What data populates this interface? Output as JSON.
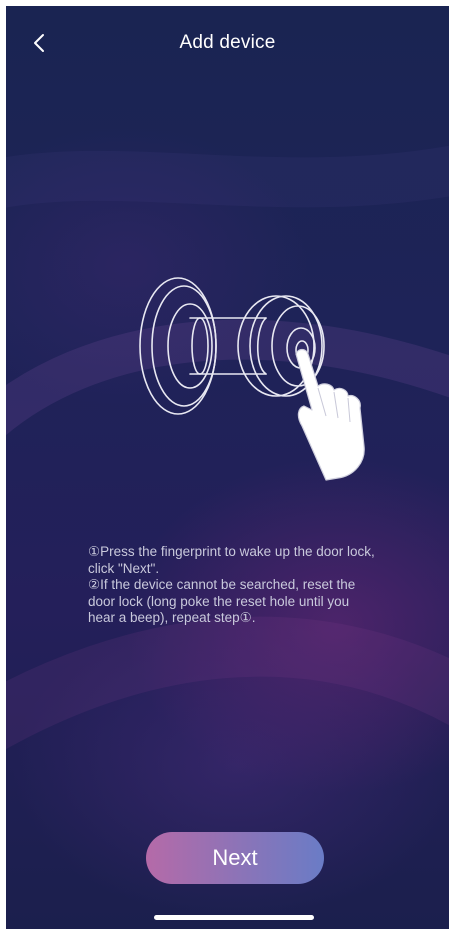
{
  "header": {
    "title": "Add device",
    "back_icon": "chevron-left-icon"
  },
  "illustration": {
    "icon": "door-lock-fingerprint-icon"
  },
  "instructions": {
    "step1": "①Press the fingerprint to wake up the door lock, click \"Next\".",
    "step2": "②If the device cannot be searched, reset the door lock (long poke the reset hole until you hear a beep), repeat step①."
  },
  "actions": {
    "next_label": "Next"
  },
  "colors": {
    "background_top": "#1a2452",
    "background_bottom": "#1b1f4d",
    "button_gradient_start": "#b56aa8",
    "button_gradient_end": "#6a7cc6"
  }
}
